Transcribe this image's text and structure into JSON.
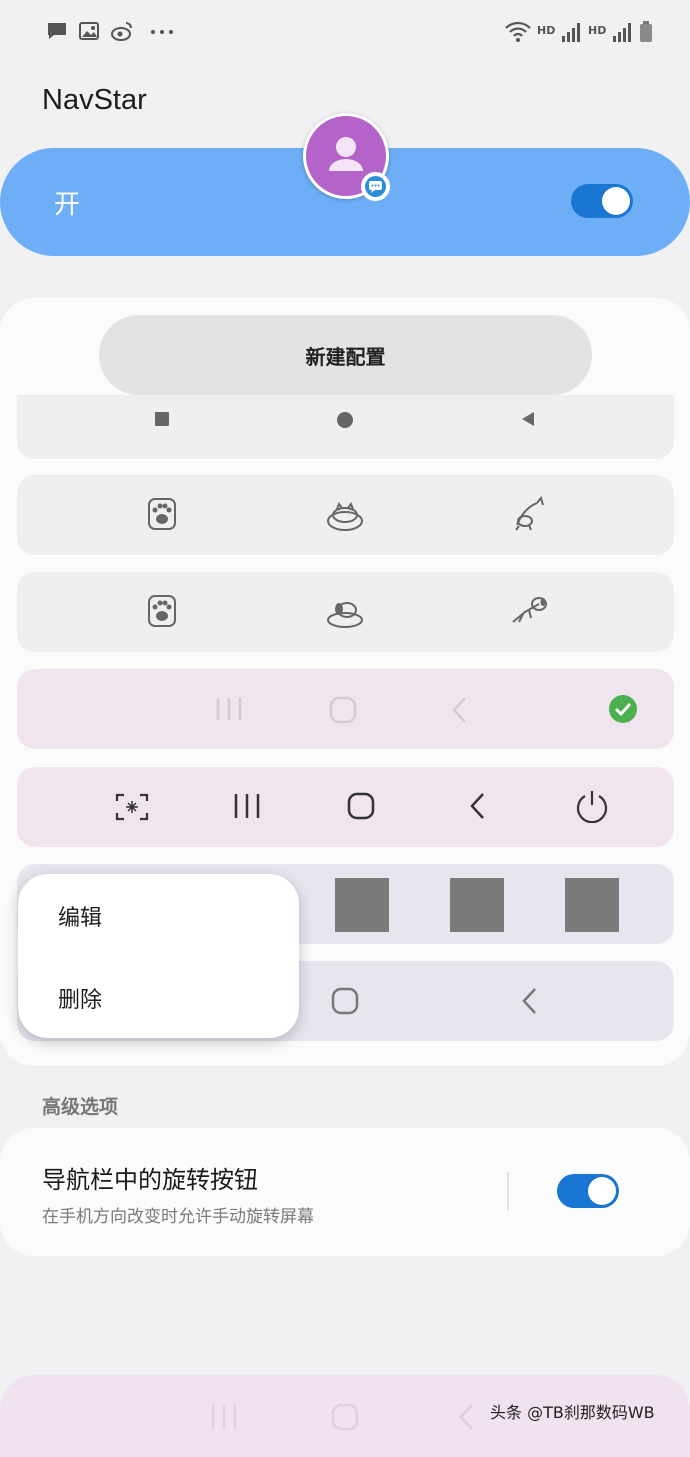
{
  "status_bar": {
    "icons": [
      "message-icon",
      "gallery-icon",
      "weibo-icon",
      "more-dots-icon",
      "wifi-icon",
      "signal-icon",
      "signal-icon",
      "battery-icon"
    ],
    "hd_label_1": "HD",
    "hd_label_2": "HD"
  },
  "app": {
    "title": "NavStar"
  },
  "master_switch": {
    "label": "开",
    "on": true,
    "accent": "#6eaef7",
    "toggle_color": "#1976d2"
  },
  "config": {
    "new_config_label": "新建配置",
    "rows": [
      {
        "style": "android-classic",
        "icons": [
          "square-icon",
          "circle-icon",
          "triangle-back-icon"
        ]
      },
      {
        "style": "cat-theme",
        "icons": [
          "paw-icon",
          "sleeping-cat-icon",
          "jumping-cat-icon"
        ]
      },
      {
        "style": "dog-theme",
        "icons": [
          "paw-icon",
          "sleeping-dog-icon",
          "jumping-dog-icon"
        ]
      },
      {
        "style": "samsung-faded",
        "icons": [
          "recents-icon",
          "home-icon",
          "back-icon"
        ],
        "selected": true
      },
      {
        "style": "samsung-extended",
        "icons": [
          "screenshot-icon",
          "recents-icon",
          "home-icon",
          "back-icon",
          "power-icon"
        ]
      },
      {
        "style": "grey-squares",
        "icons": [
          "grey-square",
          "grey-square",
          "grey-square"
        ]
      },
      {
        "style": "samsung-partial",
        "icons": [
          "home-icon",
          "back-icon"
        ]
      }
    ]
  },
  "context_menu": {
    "edit_label": "编辑",
    "delete_label": "删除"
  },
  "advanced": {
    "section_title": "高级选项",
    "rotate_option": {
      "title": "导航栏中的旋转按钮",
      "subtitle": "在手机方向改变时允许手动旋转屏幕",
      "on": true
    }
  },
  "bottom_nav": {
    "icons": [
      "recents-icon",
      "home-icon",
      "back-icon"
    ]
  },
  "watermark": "头条 @TB刹那数码WB"
}
